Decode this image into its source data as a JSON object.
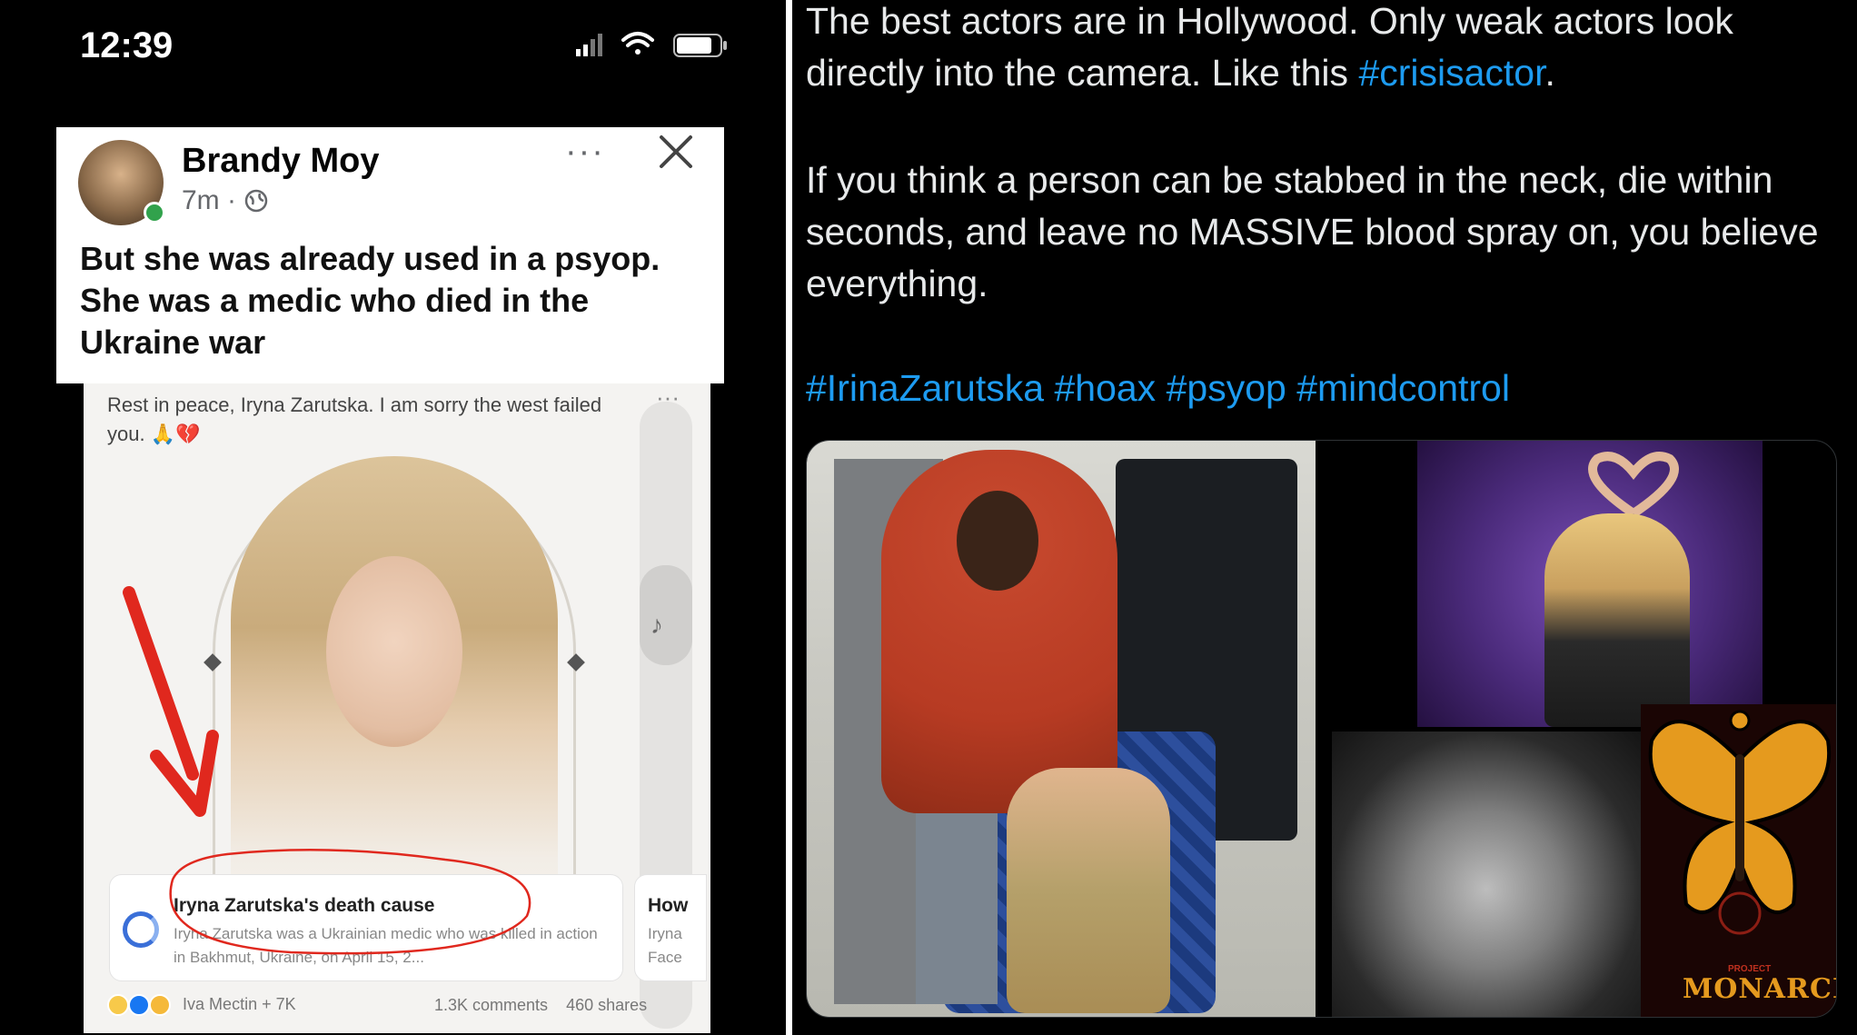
{
  "phone": {
    "time": "12:39",
    "status_icons": [
      "signal-icon",
      "wifi-icon",
      "battery-icon"
    ]
  },
  "fb_post": {
    "author": "Brandy Moy",
    "meta": "7m ·",
    "more": "···",
    "text": "But she was already used in a psyop. She was a medic who died in the Ukraine war"
  },
  "shared_image": {
    "caption": "Rest in peace, Iryna Zarutska. I am sorry the west failed you. 🙏💔",
    "dots": "···",
    "article_title": "Iryna Zarutska's death cause",
    "article_snippet": "Iryna Zarutska was a Ukrainian medic who was killed in action in Bakhmut, Ukraine, on April 15, 2...",
    "article2_title": "How",
    "article2_snippet_1": "Iryna",
    "article2_snippet_2": "Face",
    "reactions_text": "Iva Mectin + 7K",
    "comments": "1.3K comments",
    "shares": "460 shares"
  },
  "tweet": {
    "line1": "The best actors are in Hollywood. Only weak actors look directly into the camera. Like this ",
    "hashtag_crisis": "#crisisactor",
    "line1_end": ".",
    "line2": "If you think a person can be stabbed in the neck, die within seconds, and leave no MASSIVE blood spray on, you believe everything.",
    "hashtags": [
      "#IrinaZarutska",
      "#hoax",
      "#psyop",
      "#mindcontrol"
    ]
  },
  "media": {
    "project": "PROJECT",
    "monarch": "MONARCH"
  },
  "colors": {
    "hashtag": "#1d9bf0",
    "tweet_text": "#e7e9ea",
    "annotation_red": "#e0281e"
  }
}
